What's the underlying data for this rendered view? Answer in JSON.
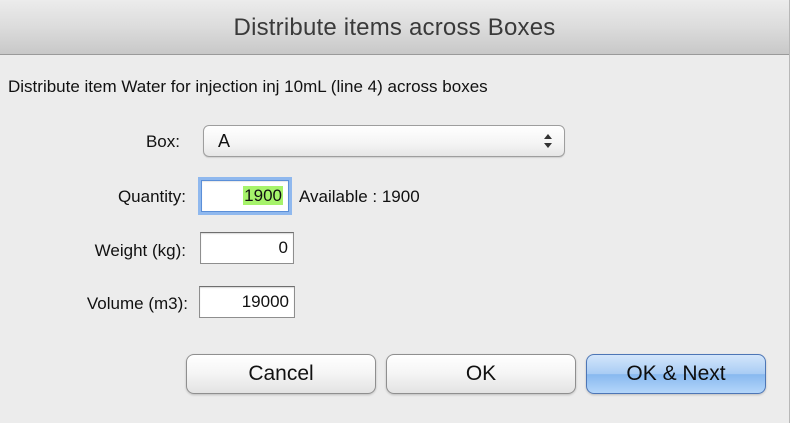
{
  "window": {
    "title": "Distribute items across Boxes"
  },
  "description": "Distribute item Water for injection inj 10mL (line 4) across boxes",
  "fields": {
    "box": {
      "label": "Box:",
      "selected": "A"
    },
    "quantity": {
      "label": "Quantity:",
      "value": "1900",
      "available_text": "Available : 1900"
    },
    "weight": {
      "label": "Weight (kg):",
      "value": "0"
    },
    "volume": {
      "label": "Volume (m3):",
      "value": "19000"
    }
  },
  "buttons": {
    "cancel": "Cancel",
    "ok": "OK",
    "ok_next": "OK & Next"
  },
  "colors": {
    "selection_highlight": "#a6f36b",
    "focus_ring": "#8fb8ee",
    "default_button": "#a9ccf4"
  }
}
